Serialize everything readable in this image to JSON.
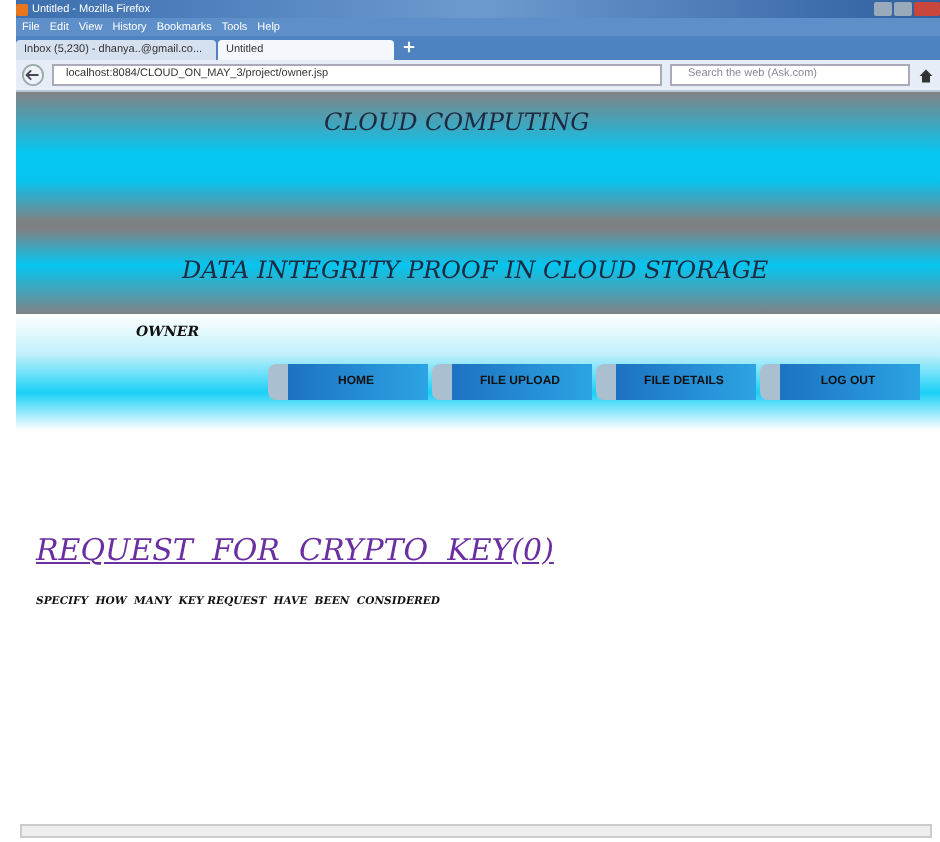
{
  "window": {
    "title": "Untitled - Mozilla Firefox"
  },
  "menu": [
    "File",
    "Edit",
    "View",
    "History",
    "Bookmarks",
    "Tools",
    "Help"
  ],
  "tabs": [
    {
      "label": "Inbox (5,230) - dhanya..@gmail.co...",
      "selected": false
    },
    {
      "label": "Untitled",
      "selected": true
    }
  ],
  "address_bar": {
    "value": "localhost:8084/CLOUD_ON_MAY_3/project/owner.jsp"
  },
  "search": {
    "placeholder": "Search the web (Ask.com)"
  },
  "banner": {
    "title": "CLOUD COMPUTING",
    "subtitle": "DATA INTEGRITY PROOF IN CLOUD STORAGE"
  },
  "role": "OWNER",
  "nav": [
    "HOME",
    "FILE UPLOAD",
    "FILE DETAILS",
    "LOG OUT"
  ],
  "heading": "REQUEST  FOR  CRYPTO  KEY(0)",
  "description": "SPECIFY  HOW  MANY  KEY REQUEST  HAVE  BEEN  CONSIDERED"
}
